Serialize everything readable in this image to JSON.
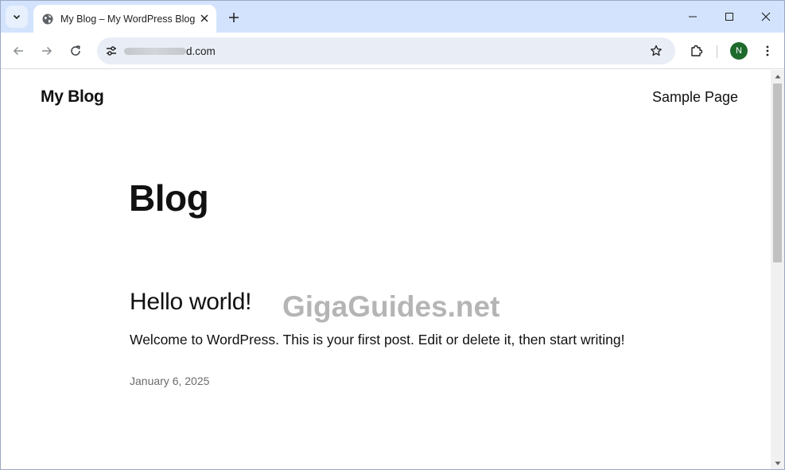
{
  "browser": {
    "tab": {
      "title": "My Blog – My WordPress Blog",
      "favicon": "globe-icon"
    },
    "address": {
      "url_visible": "d.com"
    },
    "profile_initial": "N",
    "colors": {
      "tabstrip": "#d3e3fd",
      "omnibox": "#e9eef6",
      "avatar": "#1e6a2d"
    }
  },
  "site": {
    "title": "My Blog",
    "nav": [
      {
        "label": "Sample Page"
      }
    ]
  },
  "main": {
    "heading": "Blog",
    "posts": [
      {
        "title": "Hello world!",
        "excerpt": "Welcome to WordPress. This is your first post. Edit or delete it, then start writing!",
        "date": "January 6, 2025"
      }
    ]
  },
  "watermark": "GigaGuides.net"
}
